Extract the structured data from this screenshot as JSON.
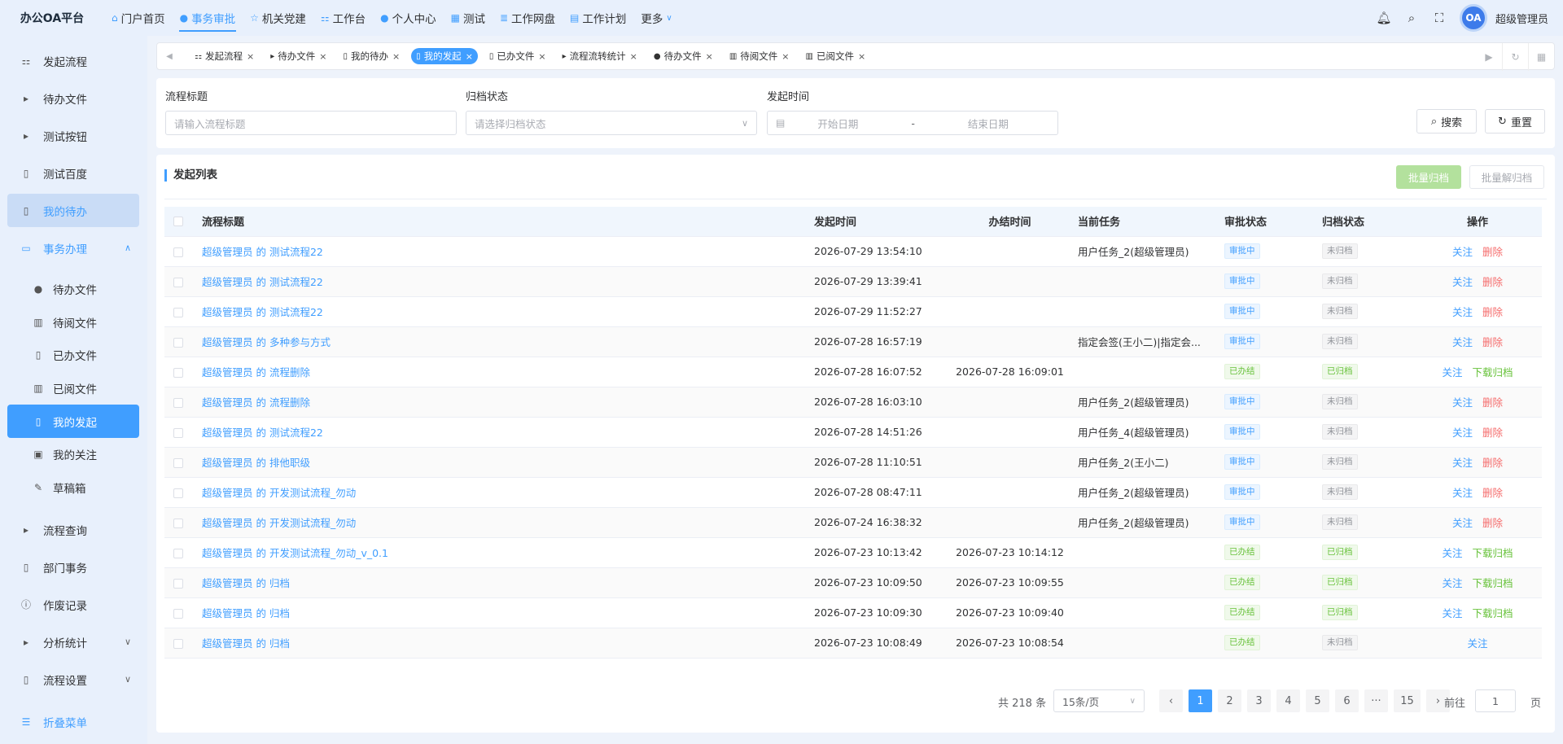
{
  "app_title": "办公OA平台",
  "topnav": [
    {
      "label": "门户首页",
      "icon": "home-icon",
      "active": false
    },
    {
      "label": "事务审批",
      "icon": "info-icon",
      "active": true
    },
    {
      "label": "机关党建",
      "icon": "star-icon",
      "active": false
    },
    {
      "label": "工作台",
      "icon": "sitemap-icon",
      "active": false
    },
    {
      "label": "个人中心",
      "icon": "user-icon",
      "active": false
    },
    {
      "label": "测试",
      "icon": "table-icon",
      "active": false
    },
    {
      "label": "工作网盘",
      "icon": "database-icon",
      "active": false
    },
    {
      "label": "工作计划",
      "icon": "calendar-icon",
      "active": false
    }
  ],
  "topnav_more": "更多",
  "avatar_text": "OA",
  "username": "超级管理员",
  "sidebar": [
    {
      "label": "发起流程",
      "icon": "sitemap-icon"
    },
    {
      "label": "待办文件",
      "icon": "caret-right-icon"
    },
    {
      "label": "测试按钮",
      "icon": "caret-right-icon"
    },
    {
      "label": "测试百度",
      "icon": "document-icon"
    },
    {
      "label": "我的待办",
      "icon": "document-icon"
    },
    {
      "label": "事务办理",
      "icon": "folder-icon"
    },
    {
      "label": "待办文件",
      "icon": "user-icon"
    },
    {
      "label": "待阅文件",
      "icon": "book-icon"
    },
    {
      "label": "已办文件",
      "icon": "file-check-icon"
    },
    {
      "label": "已阅文件",
      "icon": "book-icon"
    },
    {
      "label": "我的发起",
      "icon": "document-icon"
    },
    {
      "label": "我的关注",
      "icon": "save-icon"
    },
    {
      "label": "草稿箱",
      "icon": "pen-icon"
    },
    {
      "label": "流程查询",
      "icon": "caret-right-icon"
    },
    {
      "label": "部门事务",
      "icon": "document-icon"
    },
    {
      "label": "作废记录",
      "icon": "info-circle-icon"
    },
    {
      "label": "分析统计",
      "icon": "caret-right-icon"
    },
    {
      "label": "流程设置",
      "icon": "document-icon"
    }
  ],
  "sidebar_collapse": "折叠菜单",
  "tabs": [
    {
      "label": "发起流程",
      "icon": "sitemap-icon",
      "active": false
    },
    {
      "label": "待办文件",
      "icon": "caret-right-icon",
      "active": false
    },
    {
      "label": "我的待办",
      "icon": "document-icon",
      "active": false
    },
    {
      "label": "我的发起",
      "icon": "document-icon",
      "active": true
    },
    {
      "label": "已办文件",
      "icon": "file-check-icon",
      "active": false
    },
    {
      "label": "流程流转统计",
      "icon": "caret-right-icon",
      "active": false
    },
    {
      "label": "待办文件",
      "icon": "user-icon",
      "active": false
    },
    {
      "label": "待阅文件",
      "icon": "book-icon",
      "active": false
    },
    {
      "label": "已阅文件",
      "icon": "book-icon",
      "active": false
    }
  ],
  "filter": {
    "title_label": "流程标题",
    "title_placeholder": "请输入流程标题",
    "archive_label": "归档状态",
    "archive_placeholder": "请选择归档状态",
    "time_label": "发起时间",
    "start_placeholder": "开始日期",
    "range_sep": "-",
    "end_placeholder": "结束日期",
    "search_btn": "搜索",
    "reset_btn": "重置"
  },
  "list": {
    "title": "发起列表",
    "batch_archive": "批量归档",
    "batch_unarchive": "批量解归档",
    "columns": [
      "流程标题",
      "发起时间",
      "办结时间",
      "当前任务",
      "审批状态",
      "归档状态",
      "操作"
    ],
    "rows": [
      {
        "title": "超级管理员 的 测试流程22",
        "start": "2026-07-29 13:54:10",
        "end": "",
        "task": "用户任务_2(超级管理员)",
        "approval": "审批中",
        "archive": "未归档",
        "ops": [
          "关注",
          "删除"
        ]
      },
      {
        "title": "超级管理员 的 测试流程22",
        "start": "2026-07-29 13:39:41",
        "end": "",
        "task": "",
        "approval": "审批中",
        "archive": "未归档",
        "ops": [
          "关注",
          "删除"
        ]
      },
      {
        "title": "超级管理员 的 测试流程22",
        "start": "2026-07-29 11:52:27",
        "end": "",
        "task": "",
        "approval": "审批中",
        "archive": "未归档",
        "ops": [
          "关注",
          "删除"
        ]
      },
      {
        "title": "超级管理员 的 多种参与方式",
        "start": "2026-07-28 16:57:19",
        "end": "",
        "task": "指定会签(王小二)|指定会...",
        "approval": "审批中",
        "archive": "未归档",
        "ops": [
          "关注",
          "删除"
        ]
      },
      {
        "title": "超级管理员 的 流程删除",
        "start": "2026-07-28 16:07:52",
        "end": "2026-07-28 16:09:01",
        "task": "",
        "approval": "已办结",
        "archive": "已归档",
        "ops": [
          "关注",
          "下载归档"
        ]
      },
      {
        "title": "超级管理员 的 流程删除",
        "start": "2026-07-28 16:03:10",
        "end": "",
        "task": "用户任务_2(超级管理员)",
        "approval": "审批中",
        "archive": "未归档",
        "ops": [
          "关注",
          "删除"
        ]
      },
      {
        "title": "超级管理员 的 测试流程22",
        "start": "2026-07-28 14:51:26",
        "end": "",
        "task": "用户任务_4(超级管理员)",
        "approval": "审批中",
        "archive": "未归档",
        "ops": [
          "关注",
          "删除"
        ]
      },
      {
        "title": "超级管理员 的 排他职级",
        "start": "2026-07-28 11:10:51",
        "end": "",
        "task": "用户任务_2(王小二)",
        "approval": "审批中",
        "archive": "未归档",
        "ops": [
          "关注",
          "删除"
        ]
      },
      {
        "title": "超级管理员 的 开发测试流程_勿动",
        "start": "2026-07-28 08:47:11",
        "end": "",
        "task": "用户任务_2(超级管理员)",
        "approval": "审批中",
        "archive": "未归档",
        "ops": [
          "关注",
          "删除"
        ]
      },
      {
        "title": "超级管理员 的 开发测试流程_勿动",
        "start": "2026-07-24 16:38:32",
        "end": "",
        "task": "用户任务_2(超级管理员)",
        "approval": "审批中",
        "archive": "未归档",
        "ops": [
          "关注",
          "删除"
        ]
      },
      {
        "title": "超级管理员 的 开发测试流程_勿动_v_0.1",
        "start": "2026-07-23 10:13:42",
        "end": "2026-07-23 10:14:12",
        "task": "",
        "approval": "已办结",
        "archive": "已归档",
        "ops": [
          "关注",
          "下载归档"
        ]
      },
      {
        "title": "超级管理员 的 归档",
        "start": "2026-07-23 10:09:50",
        "end": "2026-07-23 10:09:55",
        "task": "",
        "approval": "已办结",
        "archive": "已归档",
        "ops": [
          "关注",
          "下载归档"
        ]
      },
      {
        "title": "超级管理员 的 归档",
        "start": "2026-07-23 10:09:30",
        "end": "2026-07-23 10:09:40",
        "task": "",
        "approval": "已办结",
        "archive": "已归档",
        "ops": [
          "关注",
          "下载归档"
        ]
      },
      {
        "title": "超级管理员 的 归档",
        "start": "2026-07-23 10:08:49",
        "end": "2026-07-23 10:08:54",
        "task": "",
        "approval": "已办结",
        "archive": "未归档",
        "ops": [
          "关注"
        ]
      }
    ]
  },
  "pagination": {
    "total": "共 218 条",
    "page_size": "15条/页",
    "pages": [
      "1",
      "2",
      "3",
      "4",
      "5",
      "6",
      "···",
      "15"
    ],
    "current": "1",
    "goto_label": "前往",
    "goto_value": "1",
    "page_suffix": "页"
  },
  "colors": {
    "accent": "#409eff",
    "danger": "#f56c6c",
    "success": "#67c23a"
  }
}
